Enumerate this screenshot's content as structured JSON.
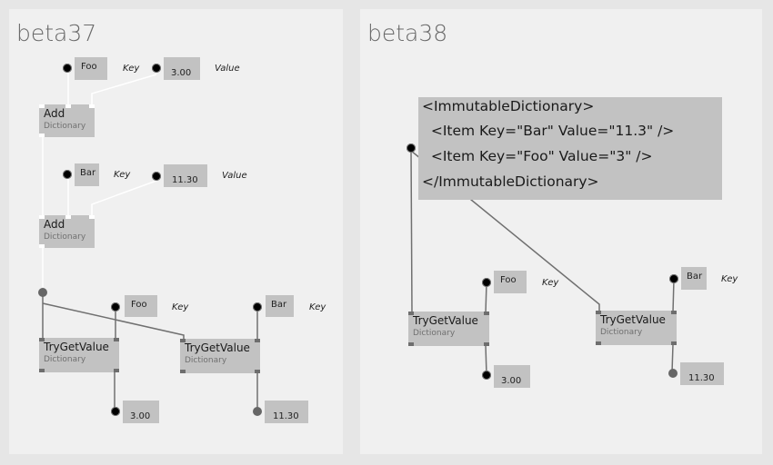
{
  "panels": [
    {
      "title": "beta37",
      "nodes": {
        "add1": {
          "name": "Add",
          "category": "Dictionary"
        },
        "add2": {
          "name": "Add",
          "category": "Dictionary"
        },
        "tgv1": {
          "name": "TryGetValue",
          "category": "Dictionary"
        },
        "tgv2": {
          "name": "TryGetValue",
          "category": "Dictionary"
        }
      },
      "inputs": {
        "key1": {
          "value": "Foo",
          "label": "Key"
        },
        "val1": {
          "value": "3.00",
          "label": "Value"
        },
        "key2": {
          "value": "Bar",
          "label": "Key"
        },
        "val2": {
          "value": "11.30",
          "label": "Value"
        },
        "key3": {
          "value": "Foo",
          "label": "Key"
        },
        "key4": {
          "value": "Bar",
          "label": "Key"
        }
      },
      "outputs": {
        "out1": {
          "value": "3.00"
        },
        "out2": {
          "value": "11.30"
        }
      }
    },
    {
      "title": "beta38",
      "dictionary_view": [
        "<ImmutableDictionary>",
        "  <Item Key=\"Bar\" Value=\"11.3\" />",
        "  <Item Key=\"Foo\" Value=\"3\" />",
        "</ImmutableDictionary>"
      ],
      "nodes": {
        "tgv1": {
          "name": "TryGetValue",
          "category": "Dictionary"
        },
        "tgv2": {
          "name": "TryGetValue",
          "category": "Dictionary"
        }
      },
      "inputs": {
        "key1": {
          "value": "Foo",
          "label": "Key"
        },
        "key2": {
          "value": "Bar",
          "label": "Key"
        }
      },
      "outputs": {
        "out1": {
          "value": "3.00"
        },
        "out2": {
          "value": "11.30"
        }
      }
    }
  ],
  "colors": {
    "background": "#e6e6e6",
    "panel": "#f0f0f0",
    "node": "#c2c2c2",
    "wire_dark": "#707070",
    "wire_light": "#ffffff"
  }
}
